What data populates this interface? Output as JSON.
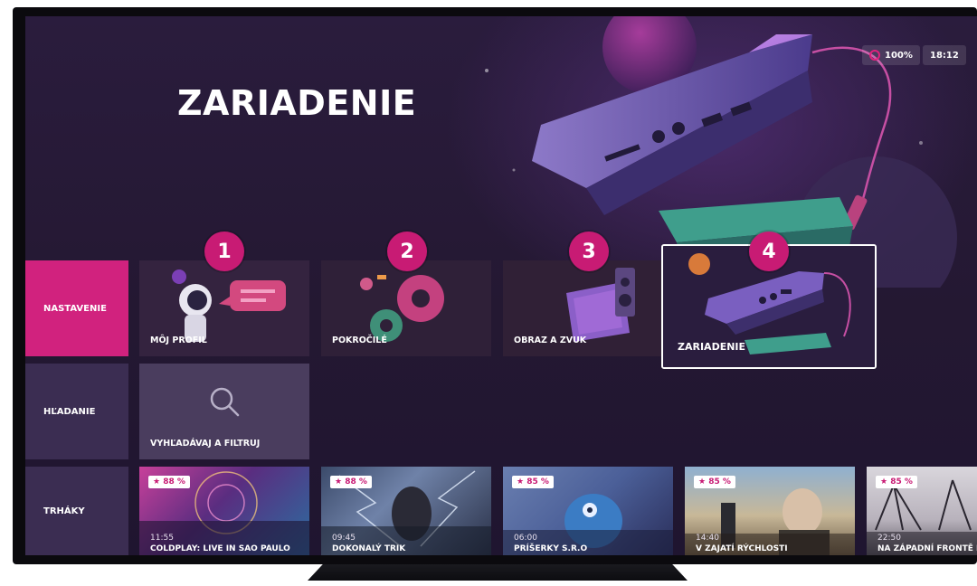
{
  "page": {
    "title": "ZARIADENIE"
  },
  "status": {
    "battery": "100%",
    "time": "18:12"
  },
  "nav": [
    {
      "label": "NASTAVENIE",
      "active": true
    },
    {
      "label": "HĽADANIE",
      "active": false
    },
    {
      "label": "TRHÁKY",
      "active": false
    }
  ],
  "settings_tiles": [
    {
      "label": "MÔJ PROFIL",
      "badge": "1"
    },
    {
      "label": "POKROČILÉ",
      "badge": "2"
    },
    {
      "label": "OBRAZ A ZVUK",
      "badge": "3"
    },
    {
      "label": "ZARIADENIE",
      "badge": "4"
    }
  ],
  "search_tile": {
    "label": "VYHĽADÁVAJ A FILTRUJ",
    "icon": "search-icon"
  },
  "movies": [
    {
      "rating": "★ 88 %",
      "time": "11:55",
      "title": "COLDPLAY: LIVE IN SAO PAULO"
    },
    {
      "rating": "★ 88 %",
      "time": "09:45",
      "title": "DOKONALÝ TRIK"
    },
    {
      "rating": "★ 85 %",
      "time": "06:00",
      "title": "PRÍŠERKY S.R.O"
    },
    {
      "rating": "★ 85 %",
      "time": "14:40",
      "title": "V ZAJATÍ RÝCHLOSTI"
    },
    {
      "rating": "★ 85 %",
      "time": "22:50",
      "title": "NA ZÁPADNÍ FRONTĚ KLID"
    }
  ],
  "colors": {
    "accent": "#d1227e",
    "badge": "#c81b74",
    "nav_bg": "#3b2d52",
    "screen_bg": "#241832"
  }
}
